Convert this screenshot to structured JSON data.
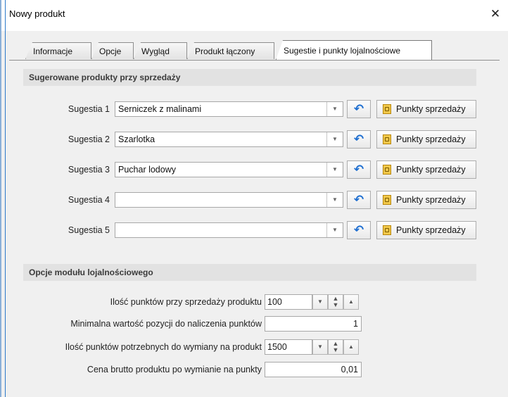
{
  "window": {
    "title": "Nowy produkt",
    "close_glyph": "✕"
  },
  "tabs": [
    {
      "label": "Informacje"
    },
    {
      "label": "Opcje"
    },
    {
      "label": "Wygląd"
    },
    {
      "label": "Produkt łączony"
    },
    {
      "label": "Sugestie i punkty lojalnościowe",
      "active": true
    }
  ],
  "suggestions": {
    "header": "Sugerowane produkty przy sprzedaży",
    "rows": [
      {
        "label": "Sugestia 1",
        "value": "Serniczek z malinami",
        "button": "Punkty sprzedaży"
      },
      {
        "label": "Sugestia 2",
        "value": "Szarlotka",
        "button": "Punkty sprzedaży"
      },
      {
        "label": "Sugestia 3",
        "value": "Puchar lodowy",
        "button": "Punkty sprzedaży"
      },
      {
        "label": "Sugestia 4",
        "value": "",
        "button": "Punkty sprzedaży"
      },
      {
        "label": "Sugestia 5",
        "value": "",
        "button": "Punkty sprzedaży"
      }
    ]
  },
  "loyalty": {
    "header": "Opcje modułu lojalnościowego",
    "points_per_sale": {
      "label": "Ilość punktów przy sprzedaży produktu",
      "value": "100"
    },
    "min_value": {
      "label": "Minimalna wartość pozycji do naliczenia punktów",
      "value": "1"
    },
    "points_needed": {
      "label": "Ilość punktów potrzebnych do wymiany na produkt",
      "value": "1500"
    },
    "gross_price": {
      "label": "Cena brutto produktu po wymianie na punkty",
      "value": "0,01"
    }
  },
  "icons": {
    "dropdown": "chevron-down-icon",
    "undo": "undo-arrow-icon",
    "points": "sales-points-icon",
    "spin_updown": "spin-updown-icon",
    "spin_up": "chevron-up-icon"
  },
  "colors": {
    "undo_blue": "#1f6fd1",
    "window_bg": "#f0f0f0",
    "section_bg": "#e2e2e2"
  }
}
